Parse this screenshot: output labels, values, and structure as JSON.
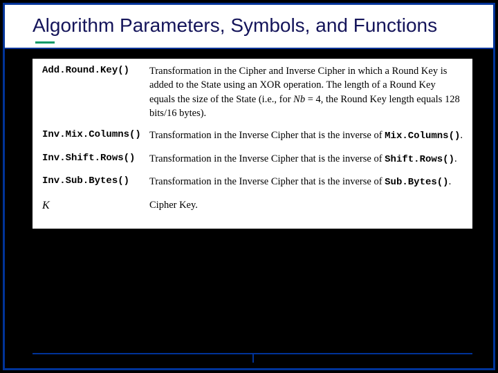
{
  "title": "Algorithm Parameters, Symbols, and Functions",
  "rows": [
    {
      "term": "Add.Round.Key()",
      "desc_pre": "Transformation in the Cipher and Inverse Cipher in which a Round Key is added to the State using an XOR operation.  The length of a Round Key equals the size of the State (i.e., for ",
      "nb": "Nb",
      "desc_mid": " = 4, the Round Key length equals 128 bits/16 bytes).",
      "kind": "addroundkey"
    },
    {
      "term": "Inv.Mix.Columns()",
      "desc_pre": "Transformation in the Inverse Cipher that is the inverse of ",
      "mono": "Mix.Columns()",
      "desc_post": ".",
      "kind": "inv"
    },
    {
      "term": "Inv.Shift.Rows()",
      "desc_pre": "Transformation in the Inverse Cipher that is the inverse of ",
      "mono": "Shift.Rows()",
      "desc_post": ".",
      "kind": "inv"
    },
    {
      "term": "Inv.Sub.Bytes()",
      "desc_pre": "Transformation in the Inverse Cipher that is the inverse of ",
      "mono": "Sub.Bytes()",
      "desc_post": ".",
      "kind": "inv"
    },
    {
      "term": "K",
      "desc_pre": "Cipher Key.",
      "kind": "key"
    }
  ]
}
